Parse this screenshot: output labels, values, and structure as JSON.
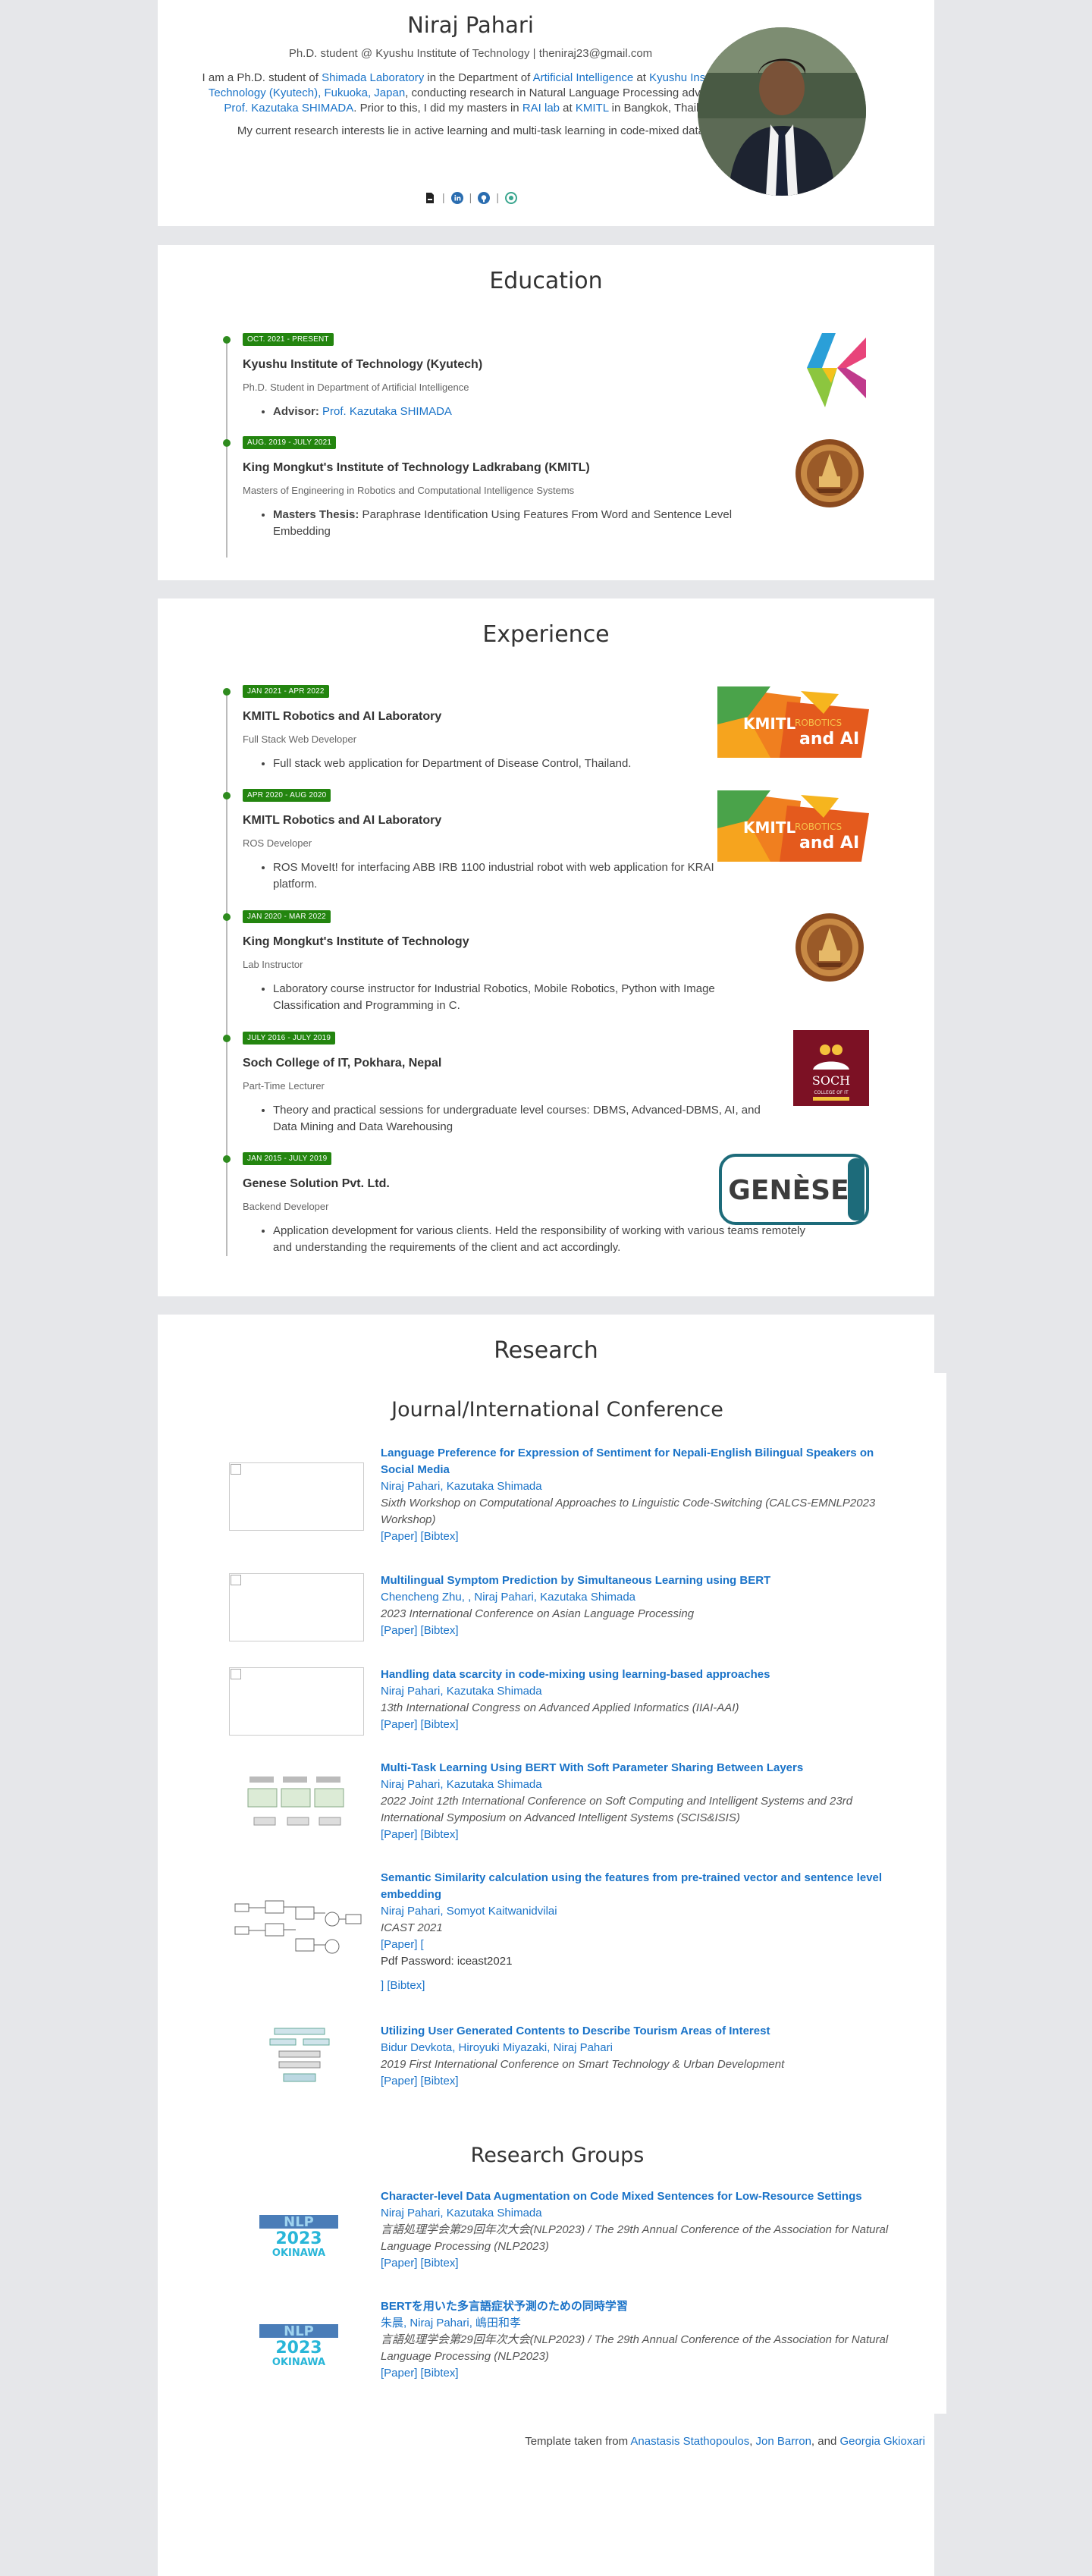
{
  "header": {
    "name": "Niraj Pahari",
    "subtitle": "Ph.D. student @ Kyushu Institute of Technology | theniraj23@gmail.com",
    "bio1_a": "I am a Ph.D. student of ",
    "bio1_lab": "Shimada Laboratory",
    "bio1_b": " in the Department of ",
    "bio1_ai": "Artificial Intelligence",
    "bio1_c": " at ",
    "bio1_uni": "Kyushu Institute of Technology (Kyutech), Fukuoka, Japan",
    "bio1_d": ", conducting research in Natural Language Processing advised by ",
    "bio1_prof": "Prof. Kazutaka SHIMADA",
    "bio1_e": ". Prior to this, I did my masters in ",
    "bio1_rai": "RAI lab",
    "bio1_f": " at ",
    "bio1_kmitl": "KMITL",
    "bio1_g": " in Bangkok, Thailand.",
    "bio2": "My current research interests lie in active learning and multi-task learning in code-mixed data.",
    "sep": "|"
  },
  "education": {
    "title": "Education",
    "items": [
      {
        "date": "OCT. 2021 - PRESENT",
        "org": "Kyushu Institute of Technology (Kyutech)",
        "role": "Ph.D. Student in Department of Artificial Intelligence",
        "bullet_label": "Advisor:",
        "bullet_link": "Prof. Kazutaka SHIMADA"
      },
      {
        "date": "AUG. 2019 - JULY 2021",
        "org": "King Mongkut's Institute of Technology Ladkrabang (KMITL)",
        "role": "Masters of Engineering in Robotics and Computational Intelligence Systems",
        "bullet_label": "Masters Thesis:",
        "bullet_text": " Paraphrase Identification Using Features From Word and Sentence Level Embedding"
      }
    ]
  },
  "experience": {
    "title": "Experience",
    "logo_kmitl_text": "KMITL",
    "logo_robotics_text": "ROBOTICS",
    "logo_andai_text": "and AI",
    "logo_soch_title": "SOCH",
    "logo_soch_sub": "COLLEGE OF IT",
    "logo_genese": "GENÈSE",
    "items": [
      {
        "date": "JAN 2021 - APR 2022",
        "org": "KMITL Robotics and AI Laboratory",
        "role": "Full Stack Web Developer",
        "bullet": "Full stack web application for Department of Disease Control, Thailand."
      },
      {
        "date": "APR 2020 - AUG 2020",
        "org": "KMITL Robotics and AI Laboratory",
        "role": "ROS Developer",
        "bullet": "ROS MoveIt! for interfacing ABB IRB 1100 industrial robot with web application for KRAI platform."
      },
      {
        "date": "JAN 2020 - MAR 2022",
        "org": "King Mongkut's Institute of Technology",
        "role": "Lab Instructor",
        "bullet": "Laboratory course instructor for Industrial Robotics, Mobile Robotics, Python with Image Classification and Programming in C."
      },
      {
        "date": "JULY 2016 - JULY 2019",
        "org": "Soch College of IT, Pokhara, Nepal",
        "role": "Part-Time Lecturer",
        "bullet": "Theory and practical sessions for undergraduate level courses: DBMS, Advanced-DBMS, AI, and Data Mining and Data Warehousing"
      },
      {
        "date": "JAN 2015 - JULY 2019",
        "org": "Genese Solution Pvt. Ltd.",
        "role": "Backend Developer",
        "bullet": "Application development for various clients. Held the responsibility of working with various teams remotely and understanding the requirements of the client and act accordingly."
      }
    ]
  },
  "research": {
    "title": "Research",
    "journal_title": "Journal/International Conference",
    "paper_label": "[Paper]",
    "bibtex_label": "[Bibtex]",
    "pubs": [
      {
        "title": "Language Preference for Expression of Sentiment for Nepali-English Bilingual Speakers on Social Media",
        "authors": "Niraj Pahari, Kazutaka Shimada",
        "venue": "Sixth Workshop on Computational Approaches to Linguistic Code-Switching (CALCS-EMNLP2023 Workshop)"
      },
      {
        "title": "Multilingual Symptom Prediction by Simultaneous Learning using BERT",
        "authors": "Chencheng Zhu, , Niraj Pahari, Kazutaka Shimada",
        "venue": "2023 International Conference on Asian Language Processing"
      },
      {
        "title": "Handling data scarcity in code-mixing using learning-based approaches",
        "authors": "Niraj Pahari, Kazutaka Shimada",
        "venue": "13th International Congress on Advanced Applied Informatics (IIAI-AAI)"
      },
      {
        "title": "Multi-Task Learning Using BERT With Soft Parameter Sharing Between Layers",
        "authors": "Niraj Pahari, Kazutaka Shimada",
        "venue": "2022 Joint 12th International Conference on Soft Computing and Intelligent Systems and 23rd International Symposium on Advanced Intelligent Systems (SCIS&ISIS)"
      },
      {
        "title": "Semantic Similarity calculation using the features from pre-trained vector and sentence level embedding",
        "authors": "Niraj Pahari, Somyot Kaitwanidvilai",
        "venue": "ICAST 2021",
        "paper_open": "[Paper] [",
        "pdf_pw": "Pdf Password: iceast2021",
        "close_bib": "] [Bibtex]"
      },
      {
        "title": "Utilizing User Generated Contents to Describe Tourism Areas of Interest",
        "authors": "Bidur Devkota, Hiroyuki Miyazaki, Niraj Pahari",
        "venue": "2019 First International Conference on Smart Technology & Urban Development"
      }
    ],
    "groups_title": "Research Groups",
    "nlp_logo_top": "NLP",
    "nlp_logo_year": "2023",
    "nlp_logo_place": "OKINAWA",
    "groups": [
      {
        "title": "Character-level Data Augmentation on Code Mixed Sentences for Low-Resource Settings",
        "authors": "Niraj Pahari, Kazutaka Shimada",
        "venue": "言語処理学会第29回年次大会(NLP2023) / The 29th Annual Conference of the Association for Natural Language Processing (NLP2023)"
      },
      {
        "title": "BERTを用いた多言語症状予測のための同時学習",
        "authors": "朱晨, Niraj Pahari, 嶋田和孝",
        "venue": "言語処理学会第29回年次大会(NLP2023) / The 29th Annual Conference of the Association for Natural Language Processing (NLP2023)"
      }
    ]
  },
  "footer": {
    "prefix": "Template taken from ",
    "n1": "Anastasis Stathopoulos",
    "c1": ", ",
    "n2": "Jon Barron",
    "c2": ", and ",
    "n3": "Georgia Gkioxari"
  },
  "colors": {
    "link": "#1a73c8",
    "badge": "#23850f",
    "timeline_dot": "#2e8b1e"
  }
}
